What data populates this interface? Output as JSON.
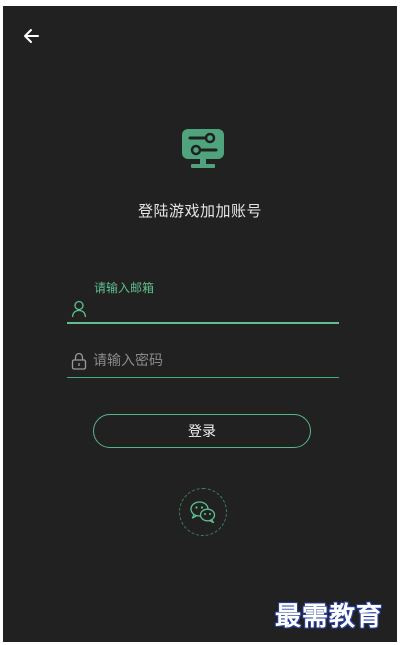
{
  "header": {
    "back_icon": "arrow-left-icon"
  },
  "logo": {
    "icon": "game-controller-icon",
    "color": "#4fa47e"
  },
  "title": "登陆游戏加加账号",
  "form": {
    "email": {
      "label": "请输入邮箱",
      "value": "",
      "icon": "user-icon"
    },
    "password": {
      "placeholder": "请输入密码",
      "value": "",
      "icon": "lock-icon"
    },
    "login_label": "登录"
  },
  "social": {
    "wechat_icon": "wechat-icon"
  },
  "watermark": "最需教育",
  "colors": {
    "background": "#212121",
    "accent": "#5fbf8f",
    "text": "#e6e6e6"
  }
}
